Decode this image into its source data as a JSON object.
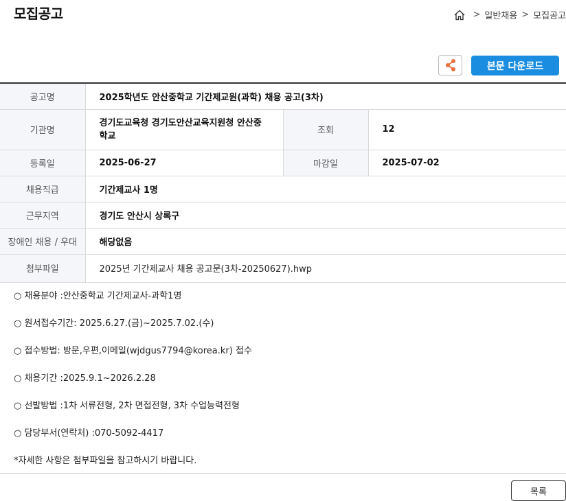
{
  "header": {
    "title": "모집공고",
    "breadcrumb": [
      "일반채용",
      "모집공고"
    ],
    "breadcrumb_sep": ">"
  },
  "toolbar": {
    "download_label": "본문 다운로드",
    "accent_color": "#1a8de0",
    "share_icon_color": "#e8703a"
  },
  "info": {
    "title_label": "공고명",
    "title_value": "2025학년도 안산중학교 기간제교원(과학) 채용 공고(3차)",
    "org_label": "기관명",
    "org_value": "경기도교육청 경기도안산교육지원청 안산중학교",
    "views_label": "조회",
    "views_value": "12",
    "reg_label": "등록일",
    "reg_value": "2025-06-27",
    "deadline_label": "마감일",
    "deadline_value": "2025-07-02",
    "rank_label": "채용직급",
    "rank_value": "기간제교사 1명",
    "region_label": "근무지역",
    "region_value": "경기도 안산시 상록구",
    "disabled_label": "장애인 채용 / 우대",
    "disabled_value": "해당없음",
    "attach_label": "첨부파일",
    "attach_value": "2025년 기간제교사 채용 공고문(3차-20250627).hwp"
  },
  "body": {
    "lines": [
      "○ 채용분야 :안산중학교 기간제교사-과학1명",
      "○ 원서접수기간: 2025.6.27.(금)~2025.7.02.(수)",
      "○ 접수방법: 방문,우편,이메일(wjdgus7794@korea.kr) 접수",
      "○ 채용기간 :2025.9.1~2026.2.28",
      "○ 선발방법 :1차 서류전형, 2차 면접전형, 3차 수업능력전형",
      "○ 담당부서(연락처) :070-5092-4417",
      "*자세한 사항은 첨부파일을 참고하시기 바랍니다."
    ]
  },
  "footer": {
    "list_label": "목록"
  }
}
